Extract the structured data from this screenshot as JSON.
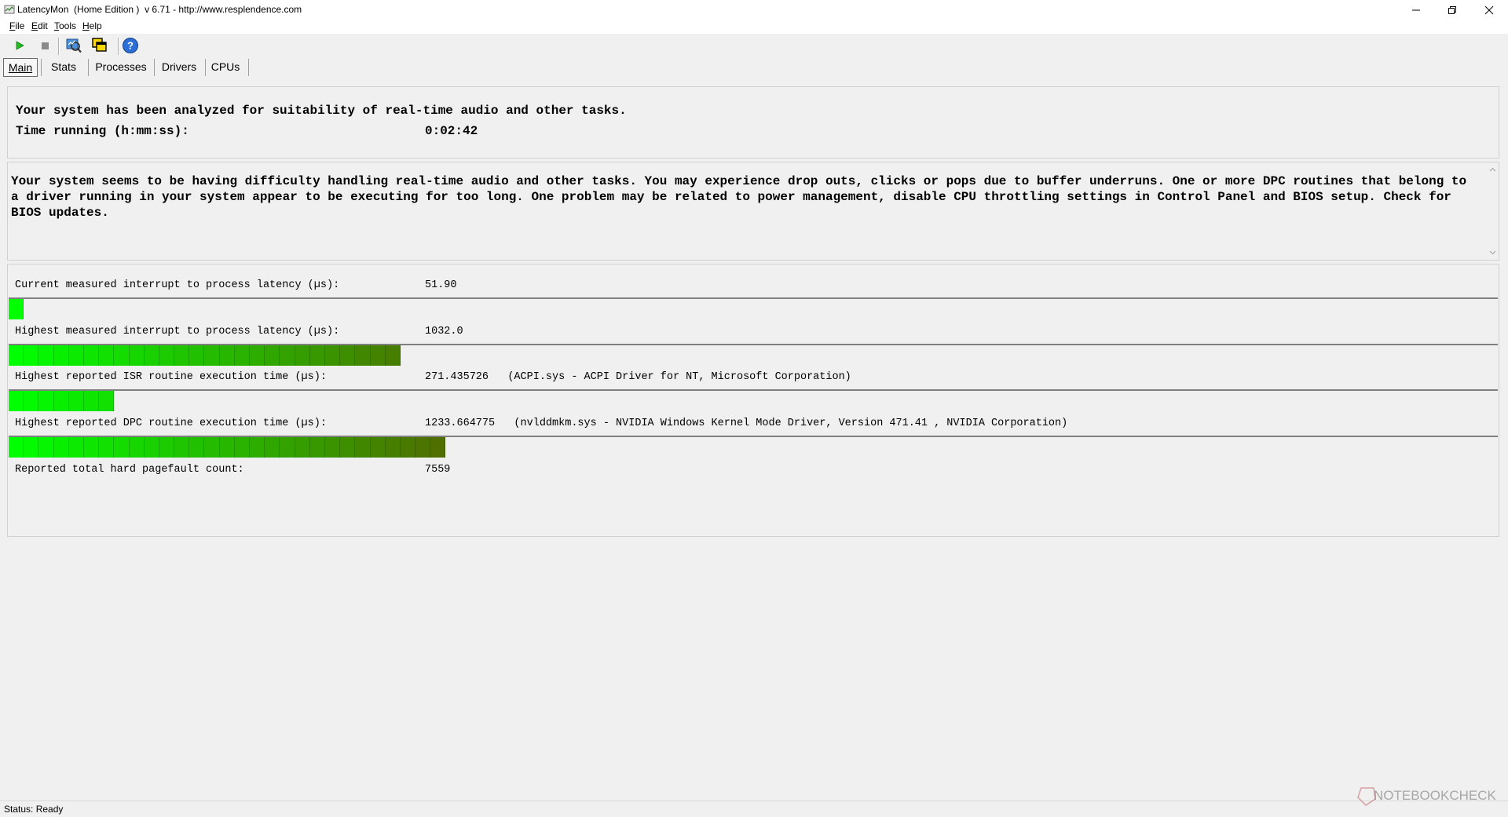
{
  "window": {
    "title": "LatencyMon  (Home Edition )  v 6.71 - http://www.resplendence.com"
  },
  "menu": {
    "file_acc": "F",
    "file_rest": "ile",
    "edit_acc": "E",
    "edit_rest": "dit",
    "tools_acc": "T",
    "tools_rest": "ools",
    "help_acc": "H",
    "help_rest": "elp"
  },
  "toolbar": {
    "icons": [
      "play-icon",
      "stop-icon",
      "analyze-icon",
      "copy-windows-icon",
      "help-icon"
    ]
  },
  "tabs": [
    {
      "label": "Main",
      "active": true
    },
    {
      "label": "Stats",
      "active": false
    },
    {
      "label": "Processes",
      "active": false
    },
    {
      "label": "Drivers",
      "active": false
    },
    {
      "label": "CPUs",
      "active": false
    }
  ],
  "summary": {
    "line1": "Your system has been analyzed for suitability of real-time audio and other tasks.",
    "time_label": "Time running (h:mm:ss):",
    "time_value": "0:02:42"
  },
  "message": "Your system seems to be having difficulty handling real-time audio and other tasks. You may experience drop outs, clicks or pops due to buffer underruns. One or more DPC routines that belong to a driver running in your system appear to be executing for too long. One problem may be related to power management, disable CPU throttling settings in Control Panel and BIOS setup. Check for BIOS updates.",
  "metrics": [
    {
      "label": "Current measured interrupt to process latency (µs):",
      "value": "51.90",
      "bar_segments": 1
    },
    {
      "label": "Highest measured interrupt to process latency (µs):",
      "value": "1032.0",
      "bar_segments": 26
    },
    {
      "label": "Highest reported ISR routine execution time (µs):",
      "value": "271.435726   (ACPI.sys - ACPI Driver for NT, Microsoft Corporation)",
      "bar_segments": 7
    },
    {
      "label": "Highest reported DPC routine execution time (µs):",
      "value": "1233.664775   (nvlddmkm.sys - NVIDIA Windows Kernel Mode Driver, Version 471.41 , NVIDIA Corporation)",
      "bar_segments": 29
    },
    {
      "label": "Reported total hard pagefault count:",
      "value": "7559"
    }
  ],
  "colors": {
    "bar_start": "#00ff00",
    "bar_end": "#5a5a00"
  },
  "status": {
    "text": "Status: Ready"
  },
  "watermark": {
    "text": "NOTEBOOKCHECK"
  }
}
